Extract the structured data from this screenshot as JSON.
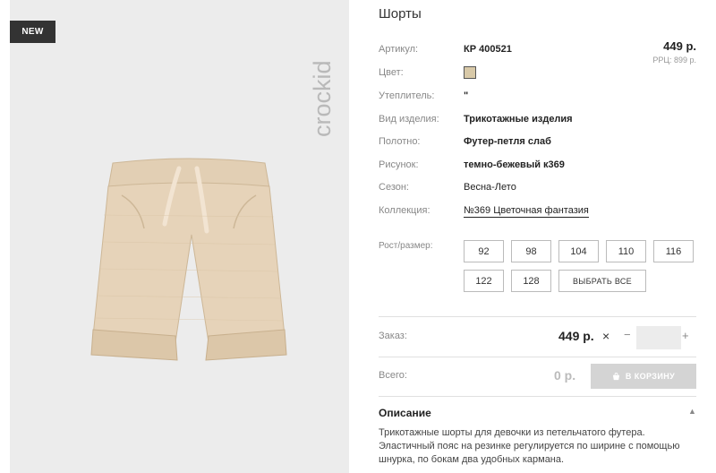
{
  "badge": "NEW",
  "brand": "crockid",
  "product": {
    "title": "Шорты",
    "rows": [
      {
        "label": "Артикул:",
        "value": "КР 400521"
      },
      {
        "label": "Цвет:",
        "value": ""
      },
      {
        "label": "Утеплитель:",
        "value": "\""
      },
      {
        "label": "Вид изделия:",
        "value": "Трикотажные изделия"
      },
      {
        "label": "Полотно:",
        "value": "Футер-петля слаб"
      },
      {
        "label": "Рисунок:",
        "value": "темно-бежевый к369"
      },
      {
        "label": "Сезон:",
        "value": "Весна-Лето"
      },
      {
        "label": "Коллекция:",
        "value": "№369 Цветочная фантазия"
      }
    ],
    "swatch_color": "#d8c9a8",
    "price": "449 р.",
    "rrp": "РРЦ: 899 р."
  },
  "sizes": {
    "label": "Рост/размер:",
    "options": [
      "92",
      "98",
      "104",
      "110",
      "116",
      "122",
      "128"
    ],
    "select_all": "ВЫБРАТЬ ВСЕ"
  },
  "order": {
    "label": "Заказ:",
    "price": "449 р.",
    "times": "×",
    "minus": "−",
    "plus": "+",
    "qty": ""
  },
  "total": {
    "label": "Всего:",
    "value": "0 р.",
    "cart_button": "В КОРЗИНУ"
  },
  "description": {
    "title": "Описание",
    "text": "Трикотажные шорты для девочки из петельчатого футера. Эластичный пояс на резинке регулируется по ширине с помощью шнурка, по бокам два удобных кармана."
  }
}
